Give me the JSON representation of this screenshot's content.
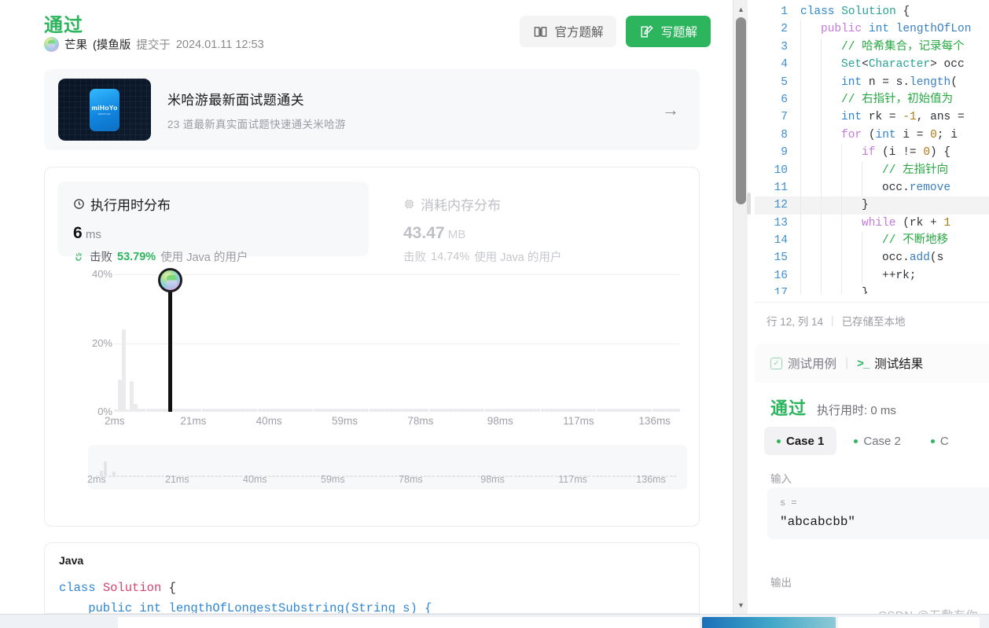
{
  "submission": {
    "verdict": "通过",
    "user_name": "芒果",
    "user_tag": "(摸鱼版",
    "submitted_prefix": "提交于",
    "submitted_at": "2024.01.11 12:53",
    "avatar_icon": "user-avatar-icon"
  },
  "header_buttons": {
    "official_solution": "官方题解",
    "official_icon": "book-icon",
    "write_solution": "写题解",
    "write_icon": "pencil-square-icon"
  },
  "promo": {
    "logo_text": "miHoYo",
    "logo_sub": "MIHOYO INC.",
    "title": "米哈游最新面试题通关",
    "subtitle": "23 道最新真实面试题快速通关米哈游",
    "arrow_icon": "arrow-right-icon"
  },
  "stats": {
    "runtime": {
      "label": "执行用时分布",
      "icon": "clock-icon",
      "value": "6",
      "unit": "ms",
      "beat_icon": "hand-clap-icon",
      "beat_prefix": "击败",
      "beat_percent": "53.79%",
      "beat_suffix": "使用 Java 的用户"
    },
    "memory": {
      "label": "消耗内存分布",
      "icon": "chip-icon",
      "value": "43.47",
      "unit": "MB",
      "beat_prefix": "击败",
      "beat_percent": "14.74%",
      "beat_suffix": "使用 Java 的用户"
    }
  },
  "chart_data": {
    "type": "bar",
    "title": "执行用时分布",
    "xlabel": "",
    "ylabel": "",
    "ylim": [
      0,
      44
    ],
    "yticks": [
      "0%",
      "20%",
      "40%"
    ],
    "ytick_values": [
      0,
      20,
      40
    ],
    "xticks": [
      "2ms",
      "21ms",
      "40ms",
      "59ms",
      "78ms",
      "98ms",
      "117ms",
      "136ms"
    ],
    "xtick_values": [
      2,
      21,
      40,
      59,
      78,
      98,
      117,
      136
    ],
    "grid": true,
    "legend": "none",
    "marker": {
      "label": "6 ms",
      "x_value": 6,
      "height_percent": 37,
      "icon": "user-avatar-marker"
    },
    "categories": [
      2,
      3,
      4,
      5,
      6,
      7,
      8,
      9,
      10,
      11,
      12,
      13,
      14,
      15,
      16,
      17,
      18,
      19,
      20,
      21,
      22,
      23,
      24,
      25,
      26,
      27,
      28,
      29,
      30,
      31,
      32,
      33,
      34,
      35,
      36,
      37,
      38,
      39,
      40,
      41,
      42,
      43,
      44,
      45,
      46,
      47,
      48,
      49,
      50,
      51,
      52,
      53,
      54,
      55,
      56,
      57,
      58,
      59,
      60,
      61,
      62,
      63,
      64,
      65,
      66,
      67,
      68,
      69,
      70,
      71,
      72,
      73,
      74,
      75,
      76,
      77,
      78,
      79,
      80,
      81,
      82,
      83,
      84,
      85,
      86,
      87,
      88,
      89,
      90,
      91,
      92,
      93,
      94,
      95,
      96,
      97,
      98,
      99,
      100,
      101,
      102,
      103,
      104,
      105,
      106,
      107,
      108,
      109,
      110,
      111,
      112,
      113,
      114,
      115,
      116,
      117,
      118,
      119,
      120,
      121,
      122,
      123,
      124,
      125,
      126,
      127,
      128,
      129,
      130,
      131,
      132,
      133,
      134,
      135,
      136,
      137,
      138,
      139,
      140,
      141,
      142,
      143,
      144,
      145
    ],
    "values": [
      0.6,
      9.5,
      24.0,
      0.6,
      9.0,
      2.2,
      1.0,
      1.0,
      1.0,
      1.0,
      1.0,
      1.0,
      1.0,
      1.0,
      1.0,
      1.0,
      1.0,
      1.0,
      1.0,
      1.0,
      1.0,
      1.0,
      1.0,
      1.0,
      1.0,
      1.0,
      1.0,
      1.0,
      1.0,
      1.0,
      1.0,
      1.0,
      1.0,
      1.0,
      1.0,
      1.0,
      1.0,
      1.0,
      1.0,
      1.0,
      1.0,
      1.0,
      1.0,
      1.0,
      1.0,
      1.0,
      1.0,
      1.0,
      1.0,
      1.0,
      1.0,
      1.0,
      1.0,
      1.0,
      1.0,
      1.0,
      1.0,
      1.0,
      1.0,
      1.0,
      1.0,
      1.0,
      1.0,
      1.0,
      1.0,
      1.0,
      1.0,
      1.0,
      1.0,
      1.0,
      1.0,
      1.0,
      1.0,
      1.0,
      1.0,
      1.0,
      1.0,
      1.0,
      1.0,
      1.0,
      1.0,
      1.0,
      1.0,
      1.0,
      1.0,
      1.0,
      1.0,
      1.0,
      1.0,
      1.0,
      1.0,
      1.0,
      1.0,
      1.0,
      1.0,
      1.0,
      1.0,
      1.0,
      1.0,
      1.0,
      1.0,
      1.0,
      1.0,
      1.0,
      1.0,
      1.0,
      1.0,
      1.0,
      1.0,
      1.0,
      1.0,
      1.0,
      1.0,
      1.0,
      1.0,
      1.0,
      1.0,
      1.0,
      1.0,
      1.0,
      1.0,
      1.0,
      1.0,
      1.0,
      1.0,
      1.0,
      1.0,
      1.0,
      1.0,
      1.0,
      1.0,
      1.0,
      1.0,
      1.0,
      1.0,
      1.0,
      1.0,
      1.0,
      1.0,
      1.0,
      1.0,
      1.0
    ]
  },
  "brush": {
    "xticks": [
      "2ms",
      "21ms",
      "40ms",
      "59ms",
      "78ms",
      "98ms",
      "117ms",
      "136ms"
    ]
  },
  "code_card": {
    "language": "Java",
    "line1": "class Solution {",
    "line2": "    public int lengthOfLongestSubstring(String s) {"
  },
  "editor": {
    "lines": [
      {
        "n": "1",
        "indent": 0,
        "tokens": [
          [
            "t-kw2",
            "class "
          ],
          [
            "t-cls",
            "Solution"
          ],
          [
            "t-pl",
            " {"
          ]
        ]
      },
      {
        "n": "2",
        "indent": 1,
        "tokens": [
          [
            "t-kw",
            "public "
          ],
          [
            "t-kw2",
            "int "
          ],
          [
            "t-fn",
            "lengthOfLon"
          ]
        ]
      },
      {
        "n": "3",
        "indent": 2,
        "tokens": [
          [
            "t-cmt",
            "// 哈希集合，记录每个"
          ]
        ]
      },
      {
        "n": "4",
        "indent": 2,
        "tokens": [
          [
            "t-cls",
            "Set"
          ],
          [
            "t-pl",
            "<"
          ],
          [
            "t-cls",
            "Character"
          ],
          [
            "t-pl",
            "> occ"
          ]
        ]
      },
      {
        "n": "5",
        "indent": 2,
        "tokens": [
          [
            "t-kw2",
            "int "
          ],
          [
            "t-pl",
            "n = s."
          ],
          [
            "t-fn",
            "length"
          ],
          [
            "t-pl",
            "("
          ]
        ]
      },
      {
        "n": "6",
        "indent": 2,
        "tokens": [
          [
            "t-cmt",
            "// 右指针，初始值为"
          ]
        ]
      },
      {
        "n": "7",
        "indent": 2,
        "tokens": [
          [
            "t-kw2",
            "int "
          ],
          [
            "t-pl",
            "rk = "
          ],
          [
            "t-num",
            "-1"
          ],
          [
            "t-pl",
            ", ans ="
          ]
        ]
      },
      {
        "n": "8",
        "indent": 2,
        "tokens": [
          [
            "t-kw",
            "for "
          ],
          [
            "t-pl",
            "("
          ],
          [
            "t-kw2",
            "int "
          ],
          [
            "t-pl",
            "i = "
          ],
          [
            "t-num",
            "0"
          ],
          [
            "t-pl",
            "; i"
          ]
        ]
      },
      {
        "n": "9",
        "indent": 3,
        "tokens": [
          [
            "t-kw",
            "if "
          ],
          [
            "t-pl",
            "(i != "
          ],
          [
            "t-num",
            "0"
          ],
          [
            "t-pl",
            ") {"
          ]
        ]
      },
      {
        "n": "10",
        "indent": 4,
        "tokens": [
          [
            "t-cmt",
            "// 左指针向"
          ]
        ]
      },
      {
        "n": "11",
        "indent": 4,
        "tokens": [
          [
            "t-pl",
            "occ."
          ],
          [
            "t-fn",
            "remove"
          ]
        ]
      },
      {
        "n": "12",
        "indent": 3,
        "tokens": [
          [
            "t-pl",
            "}"
          ]
        ],
        "highlight": true
      },
      {
        "n": "13",
        "indent": 3,
        "tokens": [
          [
            "t-kw",
            "while "
          ],
          [
            "t-pl",
            "(rk + "
          ],
          [
            "t-num",
            "1"
          ]
        ]
      },
      {
        "n": "14",
        "indent": 4,
        "tokens": [
          [
            "t-cmt",
            "// 不断地移"
          ]
        ]
      },
      {
        "n": "15",
        "indent": 4,
        "tokens": [
          [
            "t-pl",
            "occ."
          ],
          [
            "t-fn",
            "add"
          ],
          [
            "t-pl",
            "(s"
          ]
        ]
      },
      {
        "n": "16",
        "indent": 4,
        "tokens": [
          [
            "t-pl",
            "++rk;"
          ]
        ]
      },
      {
        "n": "17",
        "indent": 3,
        "tokens": [
          [
            "t-pl",
            "}"
          ]
        ]
      }
    ],
    "status_position": "行 12, 列 14",
    "status_saved": "已存储至本地"
  },
  "test_panel": {
    "tab_cases": "测试用例",
    "tab_cases_icon": "checkbox-icon",
    "tab_result": "测试结果",
    "tab_result_icon": "terminal-icon",
    "verdict": "通过",
    "runtime": "执行用时: 0 ms",
    "cases": [
      {
        "label": "Case 1",
        "active": true
      },
      {
        "label": "Case 2",
        "active": false
      },
      {
        "label": "C",
        "active": false
      }
    ],
    "input_label": "输入",
    "input_key": "s =",
    "input_value": "\"abcabcbb\"",
    "output_label": "输出"
  },
  "watermark": "CSDN @五敷有你",
  "colors": {
    "accent_green": "#2db55d",
    "bar_gray": "#ebebee",
    "marker_black": "#111111"
  }
}
